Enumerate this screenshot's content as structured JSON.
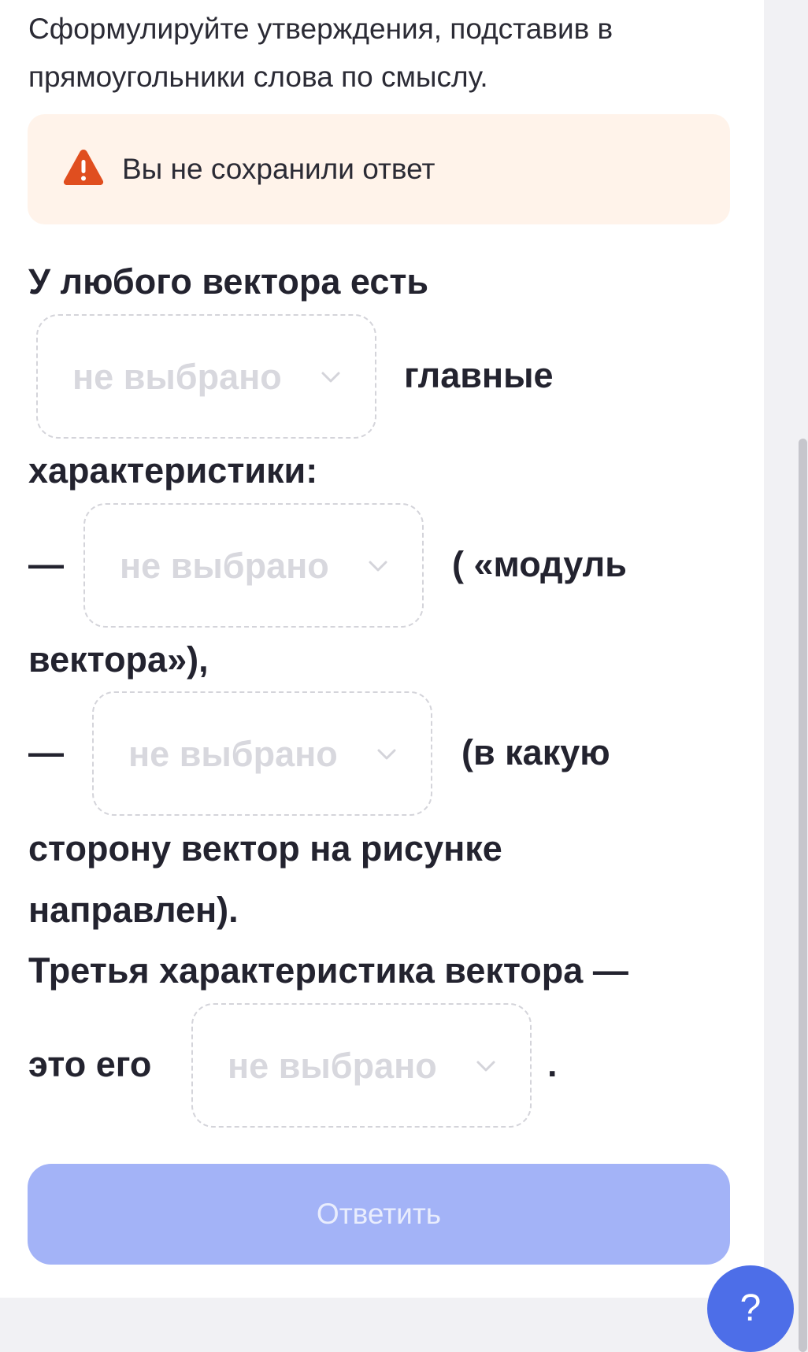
{
  "instructions": {
    "line1": "Сформулируйте утверждения, подставив в",
    "line2": "прямоугольники слова по смыслу."
  },
  "warning": {
    "icon": "warning-triangle-icon",
    "color": "#e04e1f",
    "text": "Вы не сохранили ответ"
  },
  "exercise": {
    "line1": "У любого вектора есть",
    "after_blank1": "главные",
    "line2": "характеристики:",
    "dash1": "—",
    "after_blank2": "( «модуль",
    "line3": "вектора»),",
    "dash2": "—",
    "after_blank3": "(в какую",
    "line4": "сторону вектор на рисунке",
    "line5": "направлен).",
    "line6": "Третья характеристика вектора —",
    "before_blank4": "это его",
    "after_blank4": ".",
    "blank_placeholder": "не выбрано"
  },
  "submit": {
    "label": "Ответить",
    "color": "#a3b3f7"
  },
  "help": {
    "label": "?",
    "color": "#4d6ee8"
  }
}
